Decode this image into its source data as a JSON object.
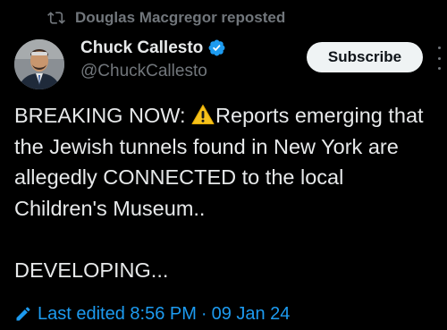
{
  "repost": {
    "icon": "repost-icon",
    "text": "Douglas Macgregor reposted"
  },
  "author": {
    "display_name": "Chuck Callesto",
    "handle": "@ChuckCallesto",
    "verified_icon": "verified-badge-icon",
    "verified_color": "#1d9bf0"
  },
  "subscribe": {
    "label": "Subscribe"
  },
  "tweet": {
    "line1_before_icon": "BREAKING NOW: ",
    "warning_icon": "warning-icon",
    "line1_after_icon": "Reports emerging that the Jewish tunnels found in New York are allegedly CONNECTED to the local Children's Museum..",
    "developing": "DEVELOPING..."
  },
  "edited": {
    "icon": "pencil-icon",
    "label": "Last edited",
    "time": "8:56 PM",
    "separator": "·",
    "date": "09 Jan 24"
  },
  "colors": {
    "background": "#000000",
    "text_primary": "#e7e9ea",
    "text_secondary": "#71767b",
    "accent": "#1d9bf0",
    "button_bg": "#eff3f4"
  }
}
